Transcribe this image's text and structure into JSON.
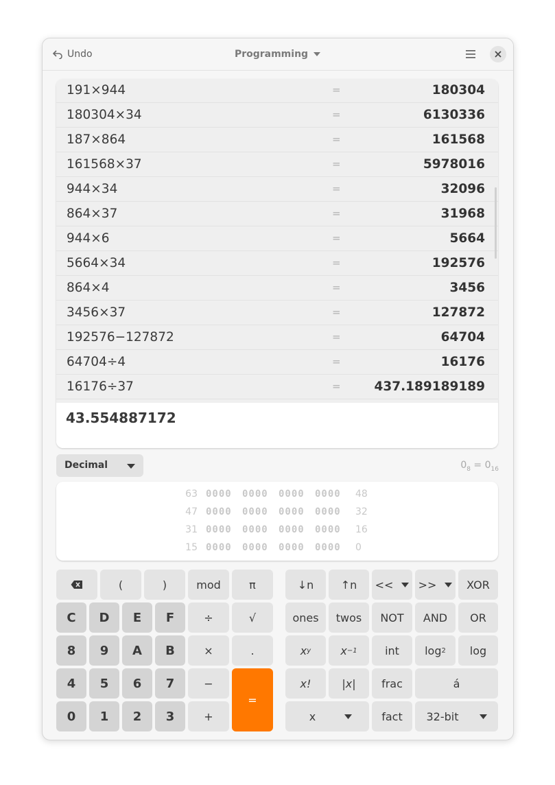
{
  "header": {
    "undo_label": "Undo",
    "mode_label": "Programming"
  },
  "history": [
    {
      "expr": "191×944",
      "res": "180304"
    },
    {
      "expr": "180304×34",
      "res": "6130336"
    },
    {
      "expr": "187×864",
      "res": "161568"
    },
    {
      "expr": "161568×37",
      "res": "5978016"
    },
    {
      "expr": "944×34",
      "res": "32096"
    },
    {
      "expr": "864×37",
      "res": "31968"
    },
    {
      "expr": "944×6",
      "res": "5664"
    },
    {
      "expr": "5664×34",
      "res": "192576"
    },
    {
      "expr": "864×4",
      "res": "3456"
    },
    {
      "expr": "3456×37",
      "res": "127872"
    },
    {
      "expr": "192576−127872",
      "res": "64704"
    },
    {
      "expr": "64704÷4",
      "res": "16176"
    },
    {
      "expr": "16176÷37",
      "res": "437.189189189"
    }
  ],
  "equals_sign": "=",
  "display": {
    "value": "43.554887172"
  },
  "base": {
    "selected": "Decimal"
  },
  "conversion": {
    "left": "0",
    "left_sub": "8",
    "mid": " = ",
    "right": "0",
    "right_sub": "16"
  },
  "bits": [
    {
      "left": "63",
      "nibbles": [
        "0000",
        "0000",
        "0000",
        "0000"
      ],
      "right": "48"
    },
    {
      "left": "47",
      "nibbles": [
        "0000",
        "0000",
        "0000",
        "0000"
      ],
      "right": "32"
    },
    {
      "left": "31",
      "nibbles": [
        "0000",
        "0000",
        "0000",
        "0000"
      ],
      "right": "16"
    },
    {
      "left": "15",
      "nibbles": [
        "0000",
        "0000",
        "0000",
        "0000"
      ],
      "right": "0"
    }
  ],
  "keypad_left": {
    "backspace_icon": "backspace-icon",
    "lparen": "(",
    "rparen": ")",
    "mod": "mod",
    "pi": "π",
    "c": "C",
    "d": "D",
    "e": "E",
    "f": "F",
    "divide": "÷",
    "sqrt": "√",
    "k8": "8",
    "k9": "9",
    "a": "A",
    "b": "B",
    "multiply": "×",
    "point": ".",
    "k4": "4",
    "k5": "5",
    "k6": "6",
    "k7": "7",
    "minus": "−",
    "equals": "=",
    "k0": "0",
    "k1": "1",
    "k2": "2",
    "k3": "3",
    "plus": "+"
  },
  "keypad_right": {
    "shift_down_n": "↓n",
    "shift_up_n": "↑n",
    "shift_left": "<<",
    "shift_right": ">>",
    "xor": "XOR",
    "ones": "ones",
    "twos": "twos",
    "not": "NOT",
    "and": "AND",
    "or": "OR",
    "pow_base": "x",
    "pow_exp": "y",
    "inv_base": "x",
    "inv_exp": "−1",
    "int": "int",
    "log2_base": "log",
    "log2_sub": "2",
    "log": "log",
    "fact_x": "x!",
    "abs": "|x|",
    "frac": "frac",
    "char": "á",
    "x_select": "x",
    "fact": "fact",
    "word_size": "32-bit"
  }
}
